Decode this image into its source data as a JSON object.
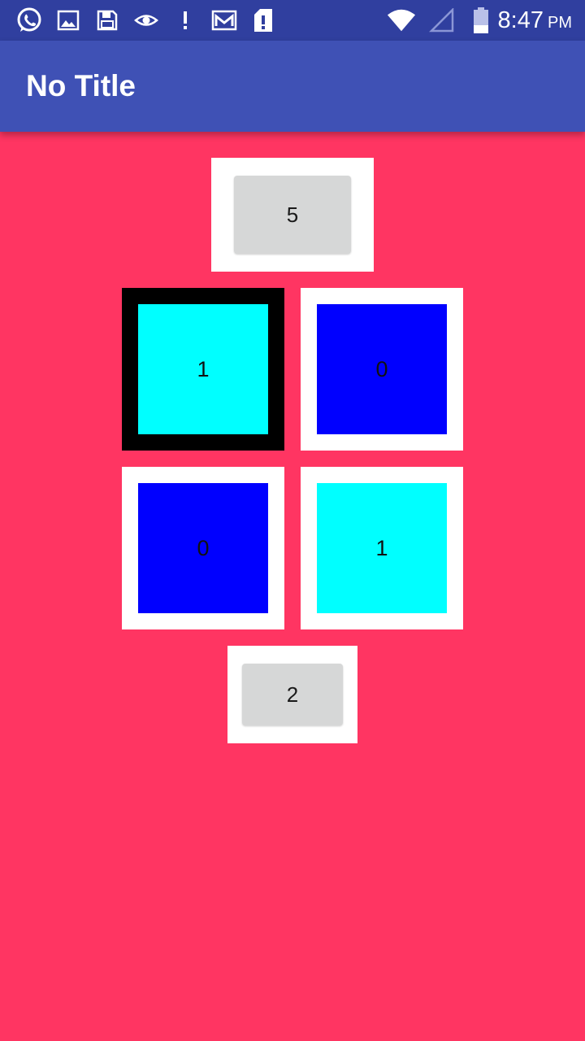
{
  "status_bar": {
    "time": "8:47",
    "ampm": "PM",
    "icons": [
      "whatsapp-icon",
      "image-icon",
      "save-icon",
      "eye-icon",
      "alert-icon",
      "gmail-icon",
      "sd-card-icon",
      "wifi-icon",
      "signal-icon",
      "battery-icon"
    ],
    "background": "#303F9F"
  },
  "app_bar": {
    "title": "No Title",
    "background": "#3F51B5"
  },
  "page": {
    "background": "#FF3562"
  },
  "board": {
    "top_button": {
      "label": "5"
    },
    "tiles": [
      {
        "value": "1",
        "color": "#00FFFF",
        "selected": true
      },
      {
        "value": "0",
        "color": "#0000FF",
        "selected": false
      },
      {
        "value": "0",
        "color": "#0000FF",
        "selected": false
      },
      {
        "value": "1",
        "color": "#00FFFF",
        "selected": false
      }
    ],
    "bottom_button": {
      "label": "2"
    }
  }
}
